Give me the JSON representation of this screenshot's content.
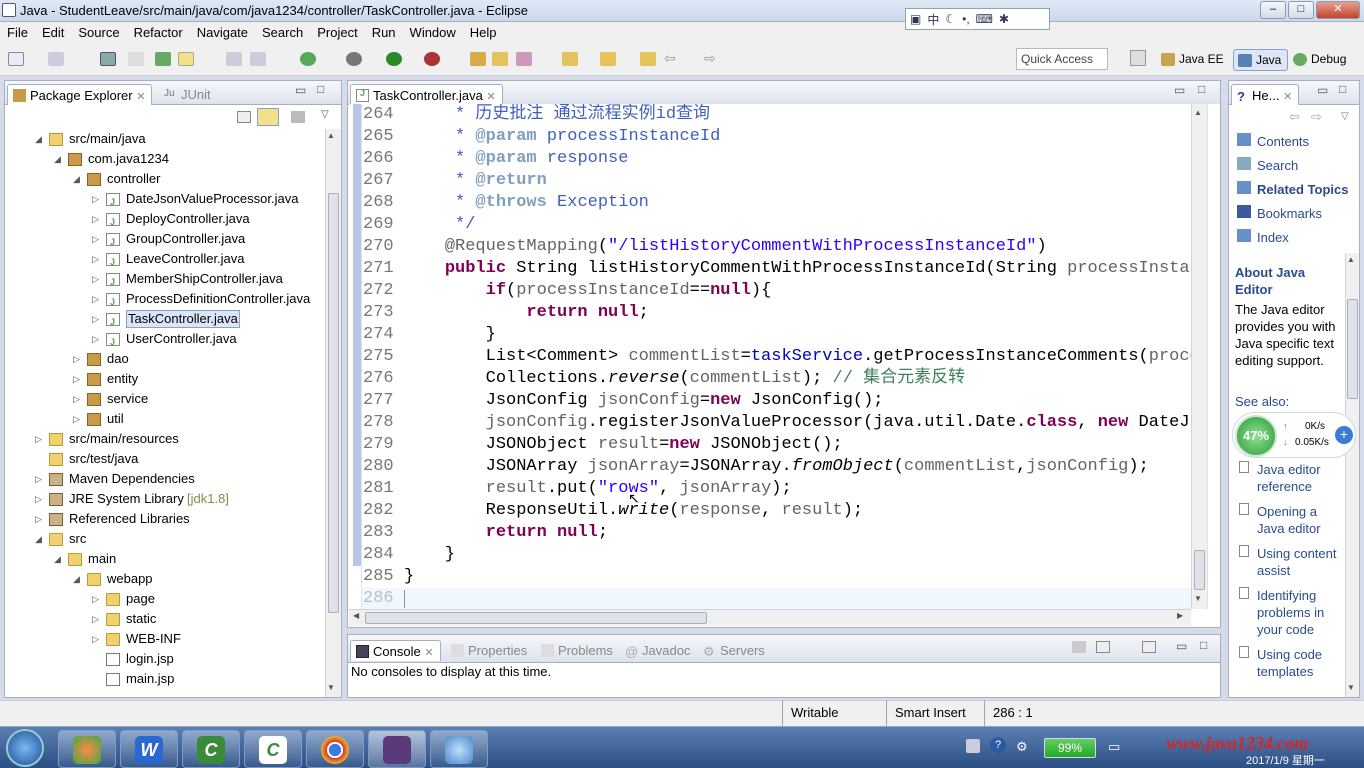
{
  "window": {
    "title": "Java - StudentLeave/src/main/java/com/java1234/controller/TaskController.java - Eclipse"
  },
  "ime": {
    "label": "中"
  },
  "menu": [
    "File",
    "Edit",
    "Source",
    "Refactor",
    "Navigate",
    "Search",
    "Project",
    "Run",
    "Window",
    "Help"
  ],
  "toolbar": {
    "quick_access": "Quick Access",
    "perspectives": [
      "Java EE",
      "Java",
      "Debug"
    ]
  },
  "explorer": {
    "tabs": [
      "Package Explorer",
      "JUnit"
    ],
    "rows": [
      {
        "label": "src/main/java",
        "indent": 1,
        "twisty": "open",
        "icon": "srcf"
      },
      {
        "label": "com.java1234",
        "indent": 2,
        "twisty": "open",
        "icon": "pkg"
      },
      {
        "label": "controller",
        "indent": 3,
        "twisty": "open",
        "icon": "pkg"
      },
      {
        "label": "DateJsonValueProcessor.java",
        "indent": 4,
        "twisty": "closed",
        "icon": "jfile"
      },
      {
        "label": "DeployController.java",
        "indent": 4,
        "twisty": "closed",
        "icon": "jfile"
      },
      {
        "label": "GroupController.java",
        "indent": 4,
        "twisty": "closed",
        "icon": "jfile"
      },
      {
        "label": "LeaveController.java",
        "indent": 4,
        "twisty": "closed",
        "icon": "jfile"
      },
      {
        "label": "MemberShipController.java",
        "indent": 4,
        "twisty": "closed",
        "icon": "jfile"
      },
      {
        "label": "ProcessDefinitionController.java",
        "indent": 4,
        "twisty": "closed",
        "icon": "jfile"
      },
      {
        "label": "TaskController.java",
        "indent": 4,
        "twisty": "closed",
        "icon": "jfile",
        "selected": true
      },
      {
        "label": "UserController.java",
        "indent": 4,
        "twisty": "closed",
        "icon": "jfile"
      },
      {
        "label": "dao",
        "indent": 3,
        "twisty": "closed",
        "icon": "pkg"
      },
      {
        "label": "entity",
        "indent": 3,
        "twisty": "closed",
        "icon": "pkg"
      },
      {
        "label": "service",
        "indent": 3,
        "twisty": "closed",
        "icon": "pkg"
      },
      {
        "label": "util",
        "indent": 3,
        "twisty": "closed",
        "icon": "pkg"
      },
      {
        "label": "src/main/resources",
        "indent": 1,
        "twisty": "closed",
        "icon": "srcf"
      },
      {
        "label": "src/test/java",
        "indent": 1,
        "twisty": "none",
        "icon": "srcf"
      },
      {
        "label": "Maven Dependencies",
        "indent": 1,
        "twisty": "closed",
        "icon": "lib"
      },
      {
        "label": "JRE System Library",
        "extra": "[jdk1.8]",
        "indent": 1,
        "twisty": "closed",
        "icon": "lib"
      },
      {
        "label": "Referenced Libraries",
        "indent": 1,
        "twisty": "closed",
        "icon": "lib"
      },
      {
        "label": "src",
        "indent": 1,
        "twisty": "open",
        "icon": "folder"
      },
      {
        "label": "main",
        "indent": 2,
        "twisty": "open",
        "icon": "folder"
      },
      {
        "label": "webapp",
        "indent": 3,
        "twisty": "open",
        "icon": "folder"
      },
      {
        "label": "page",
        "indent": 4,
        "twisty": "closed",
        "icon": "folder"
      },
      {
        "label": "static",
        "indent": 4,
        "twisty": "closed",
        "icon": "folder"
      },
      {
        "label": "WEB-INF",
        "indent": 4,
        "twisty": "closed",
        "icon": "folder"
      },
      {
        "label": "login.jsp",
        "indent": 4,
        "twisty": "none",
        "icon": "projfile"
      },
      {
        "label": "main.jsp",
        "indent": 4,
        "twisty": "none",
        "icon": "projfile"
      }
    ]
  },
  "editor": {
    "tab": "TaskController.java",
    "lines": [
      {
        "n": "264",
        "t": [
          [
            "cm",
            "     * 历史批注 通过流程实例id查询"
          ]
        ]
      },
      {
        "n": "265",
        "t": [
          [
            "cm",
            "     * "
          ],
          [
            "tag",
            "@param"
          ],
          [
            "cm",
            " processInstanceId"
          ]
        ]
      },
      {
        "n": "266",
        "t": [
          [
            "cm",
            "     * "
          ],
          [
            "tag",
            "@param"
          ],
          [
            "cm",
            " response"
          ]
        ]
      },
      {
        "n": "267",
        "t": [
          [
            "cm",
            "     * "
          ],
          [
            "tag",
            "@return"
          ]
        ]
      },
      {
        "n": "268",
        "t": [
          [
            "cm",
            "     * "
          ],
          [
            "tag",
            "@throws"
          ],
          [
            "cm",
            " Exception"
          ]
        ]
      },
      {
        "n": "269",
        "t": [
          [
            "cm",
            "     */"
          ]
        ]
      },
      {
        "n": "270",
        "t": [
          [
            "ann",
            "    @RequestMapping"
          ],
          [
            "",
            "("
          ],
          [
            "str",
            "\"/listHistoryCommentWithProcessInstanceId\""
          ],
          [
            "",
            ")"
          ]
        ]
      },
      {
        "n": "271",
        "t": [
          [
            "",
            "    "
          ],
          [
            "kw",
            "public"
          ],
          [
            "",
            " String listHistoryCommentWithProcessInstanceId(String "
          ],
          [
            "ann",
            "processInstanc"
          ]
        ]
      },
      {
        "n": "272",
        "t": [
          [
            "",
            "        "
          ],
          [
            "kw",
            "if"
          ],
          [
            "",
            "("
          ],
          [
            "ann",
            "processInstanceId"
          ],
          [
            "",
            "=="
          ],
          [
            "kw",
            "null"
          ],
          [
            "",
            "){"
          ]
        ]
      },
      {
        "n": "273",
        "t": [
          [
            "",
            "            "
          ],
          [
            "kw",
            "return null"
          ],
          [
            "",
            ";"
          ]
        ]
      },
      {
        "n": "274",
        "t": [
          [
            "",
            "        }"
          ]
        ]
      },
      {
        "n": "275",
        "t": [
          [
            "",
            "        List<Comment> "
          ],
          [
            "ann",
            "commentList"
          ],
          [
            "",
            "="
          ],
          [
            "fld",
            "taskService"
          ],
          [
            "",
            ".getProcessInstanceComments("
          ],
          [
            "ann",
            "proces"
          ]
        ]
      },
      {
        "n": "276",
        "t": [
          [
            "",
            "        Collections."
          ],
          [
            "it",
            "reverse"
          ],
          [
            "",
            "("
          ],
          [
            "ann",
            "commentList"
          ],
          [
            "",
            "); "
          ],
          [
            "cmt",
            "// 集合元素反转"
          ]
        ]
      },
      {
        "n": "277",
        "t": [
          [
            "",
            "        JsonConfig "
          ],
          [
            "ann",
            "jsonConfig"
          ],
          [
            "",
            "="
          ],
          [
            "kw",
            "new"
          ],
          [
            "",
            " JsonConfig();"
          ]
        ]
      },
      {
        "n": "278",
        "t": [
          [
            "ann",
            "        jsonConfig"
          ],
          [
            "",
            ".registerJsonValueProcessor(java.util.Date."
          ],
          [
            "kw",
            "class"
          ],
          [
            "",
            ", "
          ],
          [
            "kw",
            "new"
          ],
          [
            "",
            " DateJso"
          ]
        ]
      },
      {
        "n": "279",
        "t": [
          [
            "",
            "        JSONObject "
          ],
          [
            "ann",
            "result"
          ],
          [
            "",
            "="
          ],
          [
            "kw",
            "new"
          ],
          [
            "",
            " JSONObject();"
          ]
        ]
      },
      {
        "n": "280",
        "t": [
          [
            "",
            "        JSONArray "
          ],
          [
            "ann",
            "jsonArray"
          ],
          [
            "",
            "=JSONArray."
          ],
          [
            "it",
            "fromObject"
          ],
          [
            "",
            "("
          ],
          [
            "ann",
            "commentList"
          ],
          [
            "",
            ","
          ],
          [
            "ann",
            "jsonConfig"
          ],
          [
            "",
            ");"
          ]
        ]
      },
      {
        "n": "281",
        "t": [
          [
            "ann",
            "        result"
          ],
          [
            "",
            ".put("
          ],
          [
            "str",
            "\"rows\""
          ],
          [
            "",
            ", "
          ],
          [
            "ann",
            "jsonArray"
          ],
          [
            "",
            ");"
          ]
        ]
      },
      {
        "n": "282",
        "t": [
          [
            "",
            "        ResponseUtil."
          ],
          [
            "it",
            "write"
          ],
          [
            "",
            "("
          ],
          [
            "ann",
            "response"
          ],
          [
            "",
            ", "
          ],
          [
            "ann",
            "result"
          ],
          [
            "",
            ");"
          ]
        ]
      },
      {
        "n": "283",
        "t": [
          [
            "",
            "        "
          ],
          [
            "kw",
            "return null"
          ],
          [
            "",
            ";"
          ]
        ]
      },
      {
        "n": "284",
        "t": [
          [
            "",
            "    }"
          ]
        ]
      },
      {
        "n": "285",
        "t": [
          [
            "",
            "}"
          ]
        ]
      },
      {
        "n": "286",
        "t": [
          [
            "",
            ""
          ]
        ]
      }
    ]
  },
  "console": {
    "tabs": [
      "Console",
      "Properties",
      "Problems",
      "Javadoc",
      "Servers"
    ],
    "message": "No consoles to display at this time."
  },
  "help": {
    "tab": "He...",
    "links": [
      "Contents",
      "Search",
      "Related Topics",
      "Bookmarks",
      "Index"
    ],
    "about_title": "About Java Editor",
    "about_text": "The Java editor provides you with Java specific text editing support.",
    "see_also": "See also:",
    "items": [
      "Java editor reference",
      "Opening a Java editor",
      "Using content assist",
      "Identifying problems in your code",
      "Using code templates"
    ]
  },
  "speed": {
    "percent": "47%",
    "up": "0K/s",
    "down": "0.05K/s"
  },
  "status": {
    "writable": "Writable",
    "insert_mode": "Smart Insert",
    "position": "286 : 1"
  },
  "taskbar": {
    "battery": "99%",
    "watermark": "www.java1234.com",
    "date": "2017/1/9 星期一"
  }
}
